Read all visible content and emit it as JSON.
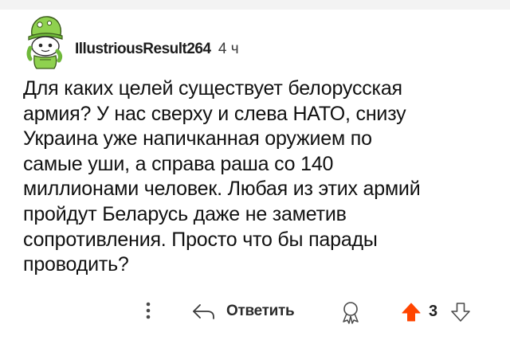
{
  "comment": {
    "username": "IllustriousResult264",
    "time": "4 ч",
    "avatar_icon": "snoo-avatar-green-hat-icon",
    "body_lines": [
      "Для каких целей существует белорусская",
      "армия? У нас сверху и слева НАТО, снизу",
      "Украина уже напичканная оружием по",
      "самые уши, а справа раша со 140",
      "миллионами человек. Любая из этих армий",
      "пройдут Беларусь даже не заметив",
      "сопротивления. Просто что бы парады",
      "проводить?"
    ]
  },
  "actions": {
    "more_icon": "vertical-ellipsis-icon",
    "reply_icon": "reply-arrow-icon",
    "reply_label": "Ответить",
    "award_icon": "award-icon",
    "upvote_icon": "upvote-arrow-icon",
    "score": "3",
    "downvote_icon": "downvote-arrow-icon"
  },
  "colors": {
    "upvote_active": "#ff4500",
    "avatar_green": "#8fd14f",
    "text": "#1a1a1b"
  }
}
